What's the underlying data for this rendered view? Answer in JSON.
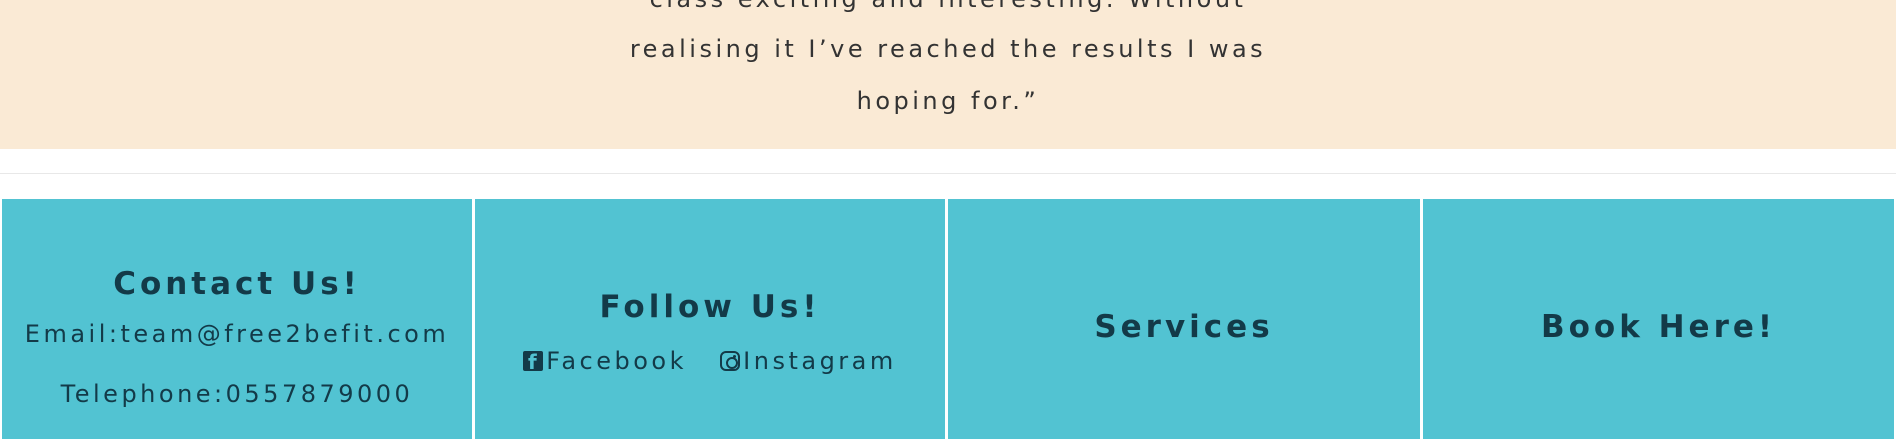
{
  "testimonial": {
    "lines": [
      "class exciting and interesting. Without",
      "realising it I’ve reached the results I was",
      "hoping for.”"
    ]
  },
  "footer": {
    "contact": {
      "heading": "Contact Us!",
      "email": "Email:team@free2befit.com",
      "telephone": "Telephone:0557879000"
    },
    "follow": {
      "heading": "Follow Us!",
      "facebook_label": "Facebook",
      "instagram_label": "Instagram",
      "facebook_icon": "facebook-icon",
      "instagram_icon": "instagram-icon"
    },
    "services": {
      "heading": "Services"
    },
    "book": {
      "heading": "Book Here!"
    }
  },
  "colors": {
    "testimonial_bg": "#faead5",
    "footer_bg": "#52c3d2",
    "footer_text": "#133a48"
  }
}
